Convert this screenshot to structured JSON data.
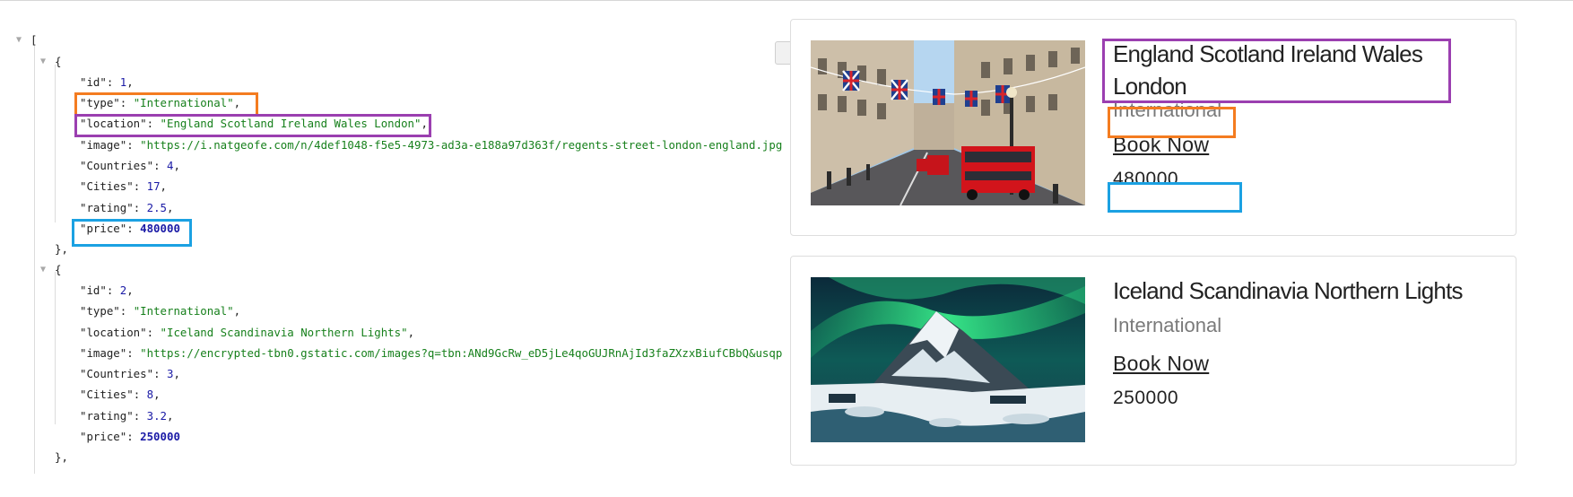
{
  "json_viewer": {
    "open_bracket": "[",
    "entries": [
      {
        "id": 1,
        "type": "International",
        "location": "England Scotland Ireland Wales London",
        "image": "https://i.natgeofe.com/n/4def1048-f5e5-4973-ad3a-e188a97d363f/regents-street-london-england.jpg",
        "Countries": 4,
        "Cities": 17,
        "rating": 2.5,
        "price": 480000
      },
      {
        "id": 2,
        "type": "International",
        "location": "Iceland Scandinavia Northern Lights",
        "image": "https://encrypted-tbn0.gstatic.com/images?q=tbn:ANd9GcRw_eD5jLe4qoGUJRnAjId3faZXzxBiufCBbQ&usqp=C",
        "Countries": 3,
        "Cities": 8,
        "rating": 3.2,
        "price": 250000
      }
    ]
  },
  "cards": [
    {
      "title": "England Scotland Ireland Wales London",
      "type": "International",
      "book_label": "Book Now",
      "price": "480000",
      "image_subject": "london-street-photo"
    },
    {
      "title": "Iceland Scandinavia Northern Lights",
      "type": "International",
      "book_label": "Book Now",
      "price": "250000",
      "image_subject": "northern-lights-photo"
    }
  ],
  "highlight_colors": {
    "type": "#f47c20",
    "location": "#9b3fb0",
    "price": "#1ba1e2"
  }
}
